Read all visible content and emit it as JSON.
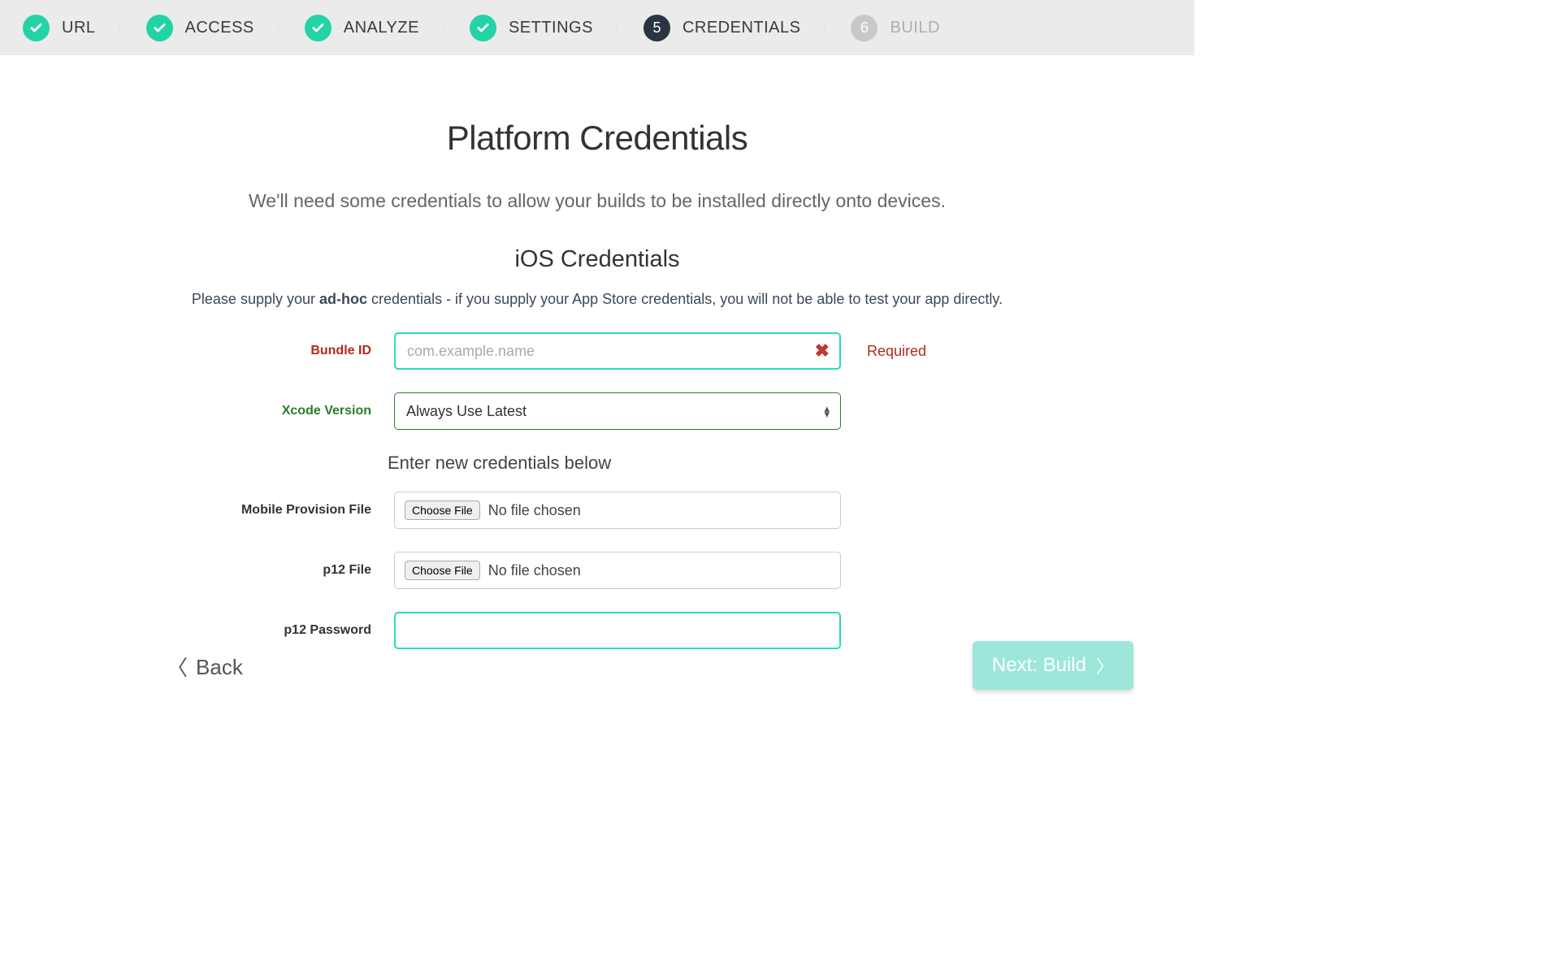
{
  "stepper": {
    "steps": [
      {
        "label": "URL",
        "state": "done"
      },
      {
        "label": "ACCESS",
        "state": "done"
      },
      {
        "label": "ANALYZE",
        "state": "done"
      },
      {
        "label": "SETTINGS",
        "state": "done"
      },
      {
        "label": "CREDENTIALS",
        "state": "active",
        "num": "5"
      },
      {
        "label": "BUILD",
        "state": "todo",
        "num": "6"
      }
    ]
  },
  "main": {
    "title": "Platform Credentials",
    "subtitle": "We'll need some credentials to allow your builds to be installed directly onto devices.",
    "section_heading": "iOS Credentials",
    "section_note_pre": "Please supply your ",
    "section_note_bold": "ad-hoc",
    "section_note_post": " credentials - if you supply your App Store credentials, you will not be able to test your app directly.",
    "sub_heading": "Enter new credentials below"
  },
  "form": {
    "bundle_id": {
      "label": "Bundle ID",
      "placeholder": "com.example.name",
      "value": "",
      "aux": "Required"
    },
    "xcode": {
      "label": "Xcode Version",
      "selected": "Always Use Latest"
    },
    "provision": {
      "label": "Mobile Provision File",
      "choose": "Choose File",
      "file_text": "No file chosen"
    },
    "p12file": {
      "label": "p12 File",
      "choose": "Choose File",
      "file_text": "No file chosen"
    },
    "p12pass": {
      "label": "p12 Password",
      "value": ""
    }
  },
  "footer": {
    "back": "Back",
    "next": "Next: Build"
  }
}
